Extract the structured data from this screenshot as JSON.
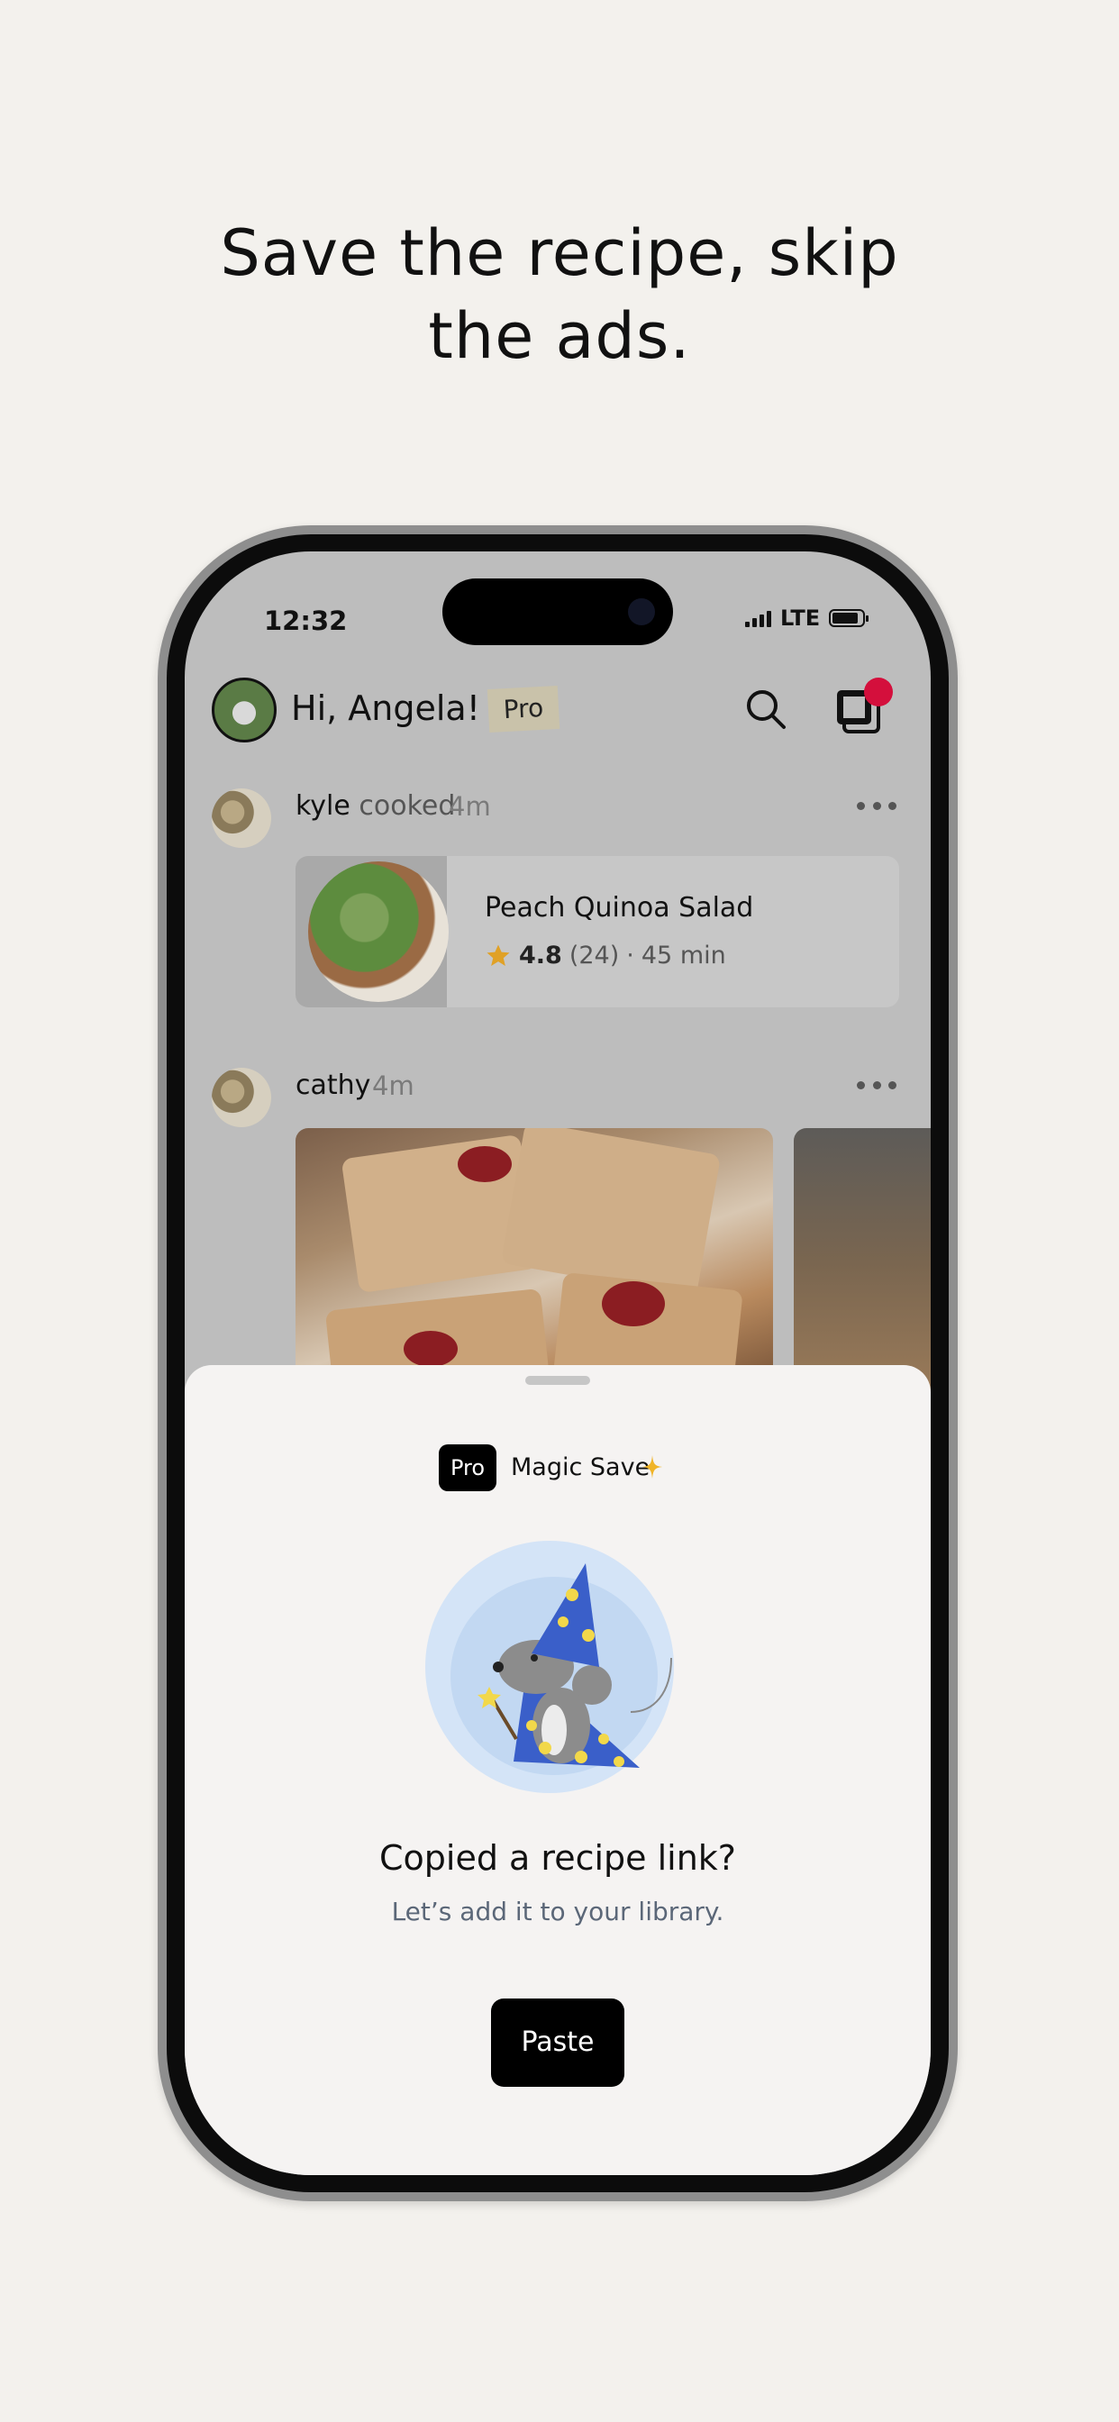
{
  "headline": {
    "line1": "Save the recipe, skip",
    "line2": "the ads."
  },
  "status_bar": {
    "time": "12:32",
    "network": "LTE"
  },
  "header": {
    "greeting": "Hi, Angela!",
    "pro_tag": "Pro",
    "icons": [
      "search-icon",
      "library-icon"
    ],
    "notification_color": "#d40f3c"
  },
  "feed": [
    {
      "user": "kyle",
      "action": "cooked",
      "time": "4m",
      "recipe": {
        "title": "Peach Quinoa Salad",
        "rating": "4.8",
        "reviews": "(24)",
        "separator": "·",
        "duration": "45 min"
      }
    },
    {
      "user": "cathy",
      "time": "4m"
    }
  ],
  "sheet": {
    "badge": "Pro",
    "label": "Magic Save",
    "title": "Copied a recipe link?",
    "subtitle": "Let’s add it to your library.",
    "button": "Paste"
  },
  "colors": {
    "background": "#f3f1ed",
    "accent_star": "#e0a126",
    "sheet_bg": "#f5f3f2",
    "button_bg": "#000000"
  }
}
